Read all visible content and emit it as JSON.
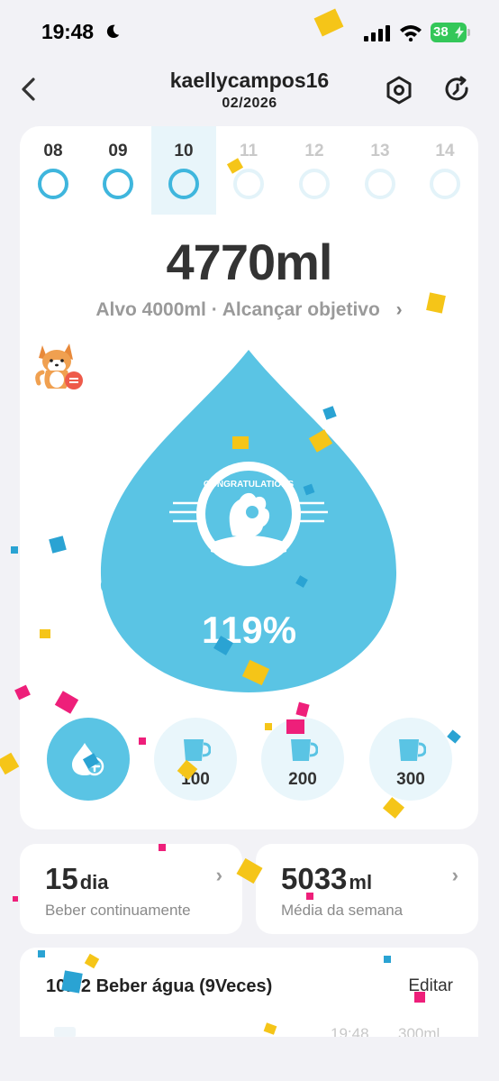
{
  "status_bar": {
    "time": "19:48",
    "battery": "38"
  },
  "header": {
    "username": "kaellycampos16",
    "month": "02/2026"
  },
  "days": [
    {
      "label": "08",
      "state": "past"
    },
    {
      "label": "09",
      "state": "past"
    },
    {
      "label": "10",
      "state": "selected"
    },
    {
      "label": "11",
      "state": "future"
    },
    {
      "label": "12",
      "state": "future"
    },
    {
      "label": "13",
      "state": "future"
    },
    {
      "label": "14",
      "state": "future"
    }
  ],
  "summary": {
    "total": "4770ml",
    "goal_text": "Alvo 4000ml · Alcançar objetivo",
    "badge_text": "CONGRATULATIONS",
    "percent": "119%"
  },
  "cups": [
    {
      "label": "100"
    },
    {
      "label": "200"
    },
    {
      "label": "300"
    }
  ],
  "stats": {
    "streak_value": "15",
    "streak_unit": "dia",
    "streak_label": "Beber continuamente",
    "week_value": "5033",
    "week_unit": "ml",
    "week_label": "Média da semana"
  },
  "record": {
    "title": "10.02 Beber água (9Veces)",
    "edit": "Editar",
    "row_time": "19:48",
    "row_amount": "300ml"
  },
  "colors": {
    "accent": "#5ac4e4",
    "ring": "#3fb6dd",
    "background": "#f2f2f6",
    "confetti_yellow": "#f5c518",
    "confetti_pink": "#ee1f7a",
    "confetti_blue": "#2aa3d3"
  }
}
